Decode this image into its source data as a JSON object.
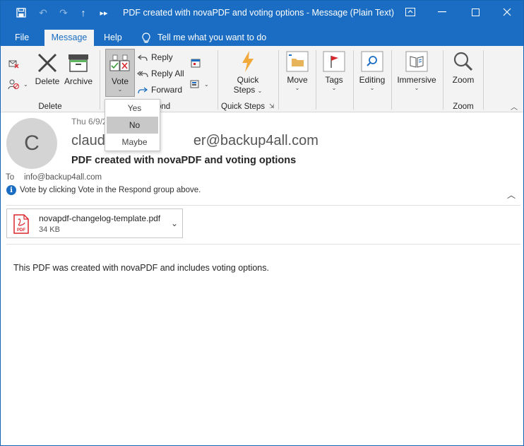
{
  "window": {
    "title": "PDF created with novaPDF and voting options  -  Message (Plain Text)"
  },
  "tabs": [
    {
      "label": "File",
      "active": false
    },
    {
      "label": "Message",
      "active": true
    },
    {
      "label": "Help",
      "active": false
    }
  ],
  "tell_me": "Tell me what you want to do",
  "ribbon": {
    "delete_group": {
      "label": "Delete",
      "delete_btn": "Delete",
      "archive_btn": "Archive"
    },
    "respond_group": {
      "label": "Respond",
      "label_visible": "ond",
      "vote_btn": "Vote",
      "reply_btn": "Reply",
      "reply_all_btn": "Reply All",
      "forward_btn": "Forward"
    },
    "quick_steps_group": {
      "label": "Quick Steps",
      "btn_line1": "Quick",
      "btn_line2": "Steps"
    },
    "move_btn": "Move",
    "tags_btn": "Tags",
    "editing_btn": "Editing",
    "immersive_btn": "Immersive",
    "zoom_group": {
      "label": "Zoom",
      "zoom_btn": "Zoom"
    }
  },
  "vote_menu": {
    "options": [
      "Yes",
      "No",
      "Maybe"
    ],
    "highlighted": "No"
  },
  "message": {
    "avatar_initial": "C",
    "date": "Thu 6/9/2",
    "sender_visible_left": "claud",
    "sender_visible_right": "er@backup4all.com",
    "subject": "PDF created with novaPDF and voting options",
    "to_label": "To",
    "to": "info@backup4all.com",
    "info_bar": "Vote by clicking Vote in the Respond group above.",
    "attachment": {
      "name": "novapdf-changelog-template.pdf",
      "size": "34 KB",
      "icon_label": "PDF"
    },
    "body": "This PDF was created with novaPDF and includes voting options."
  },
  "colors": {
    "accent": "#1a6dc2",
    "ribbon_bg": "#f3f3f3",
    "pdf_red": "#d9262c"
  }
}
